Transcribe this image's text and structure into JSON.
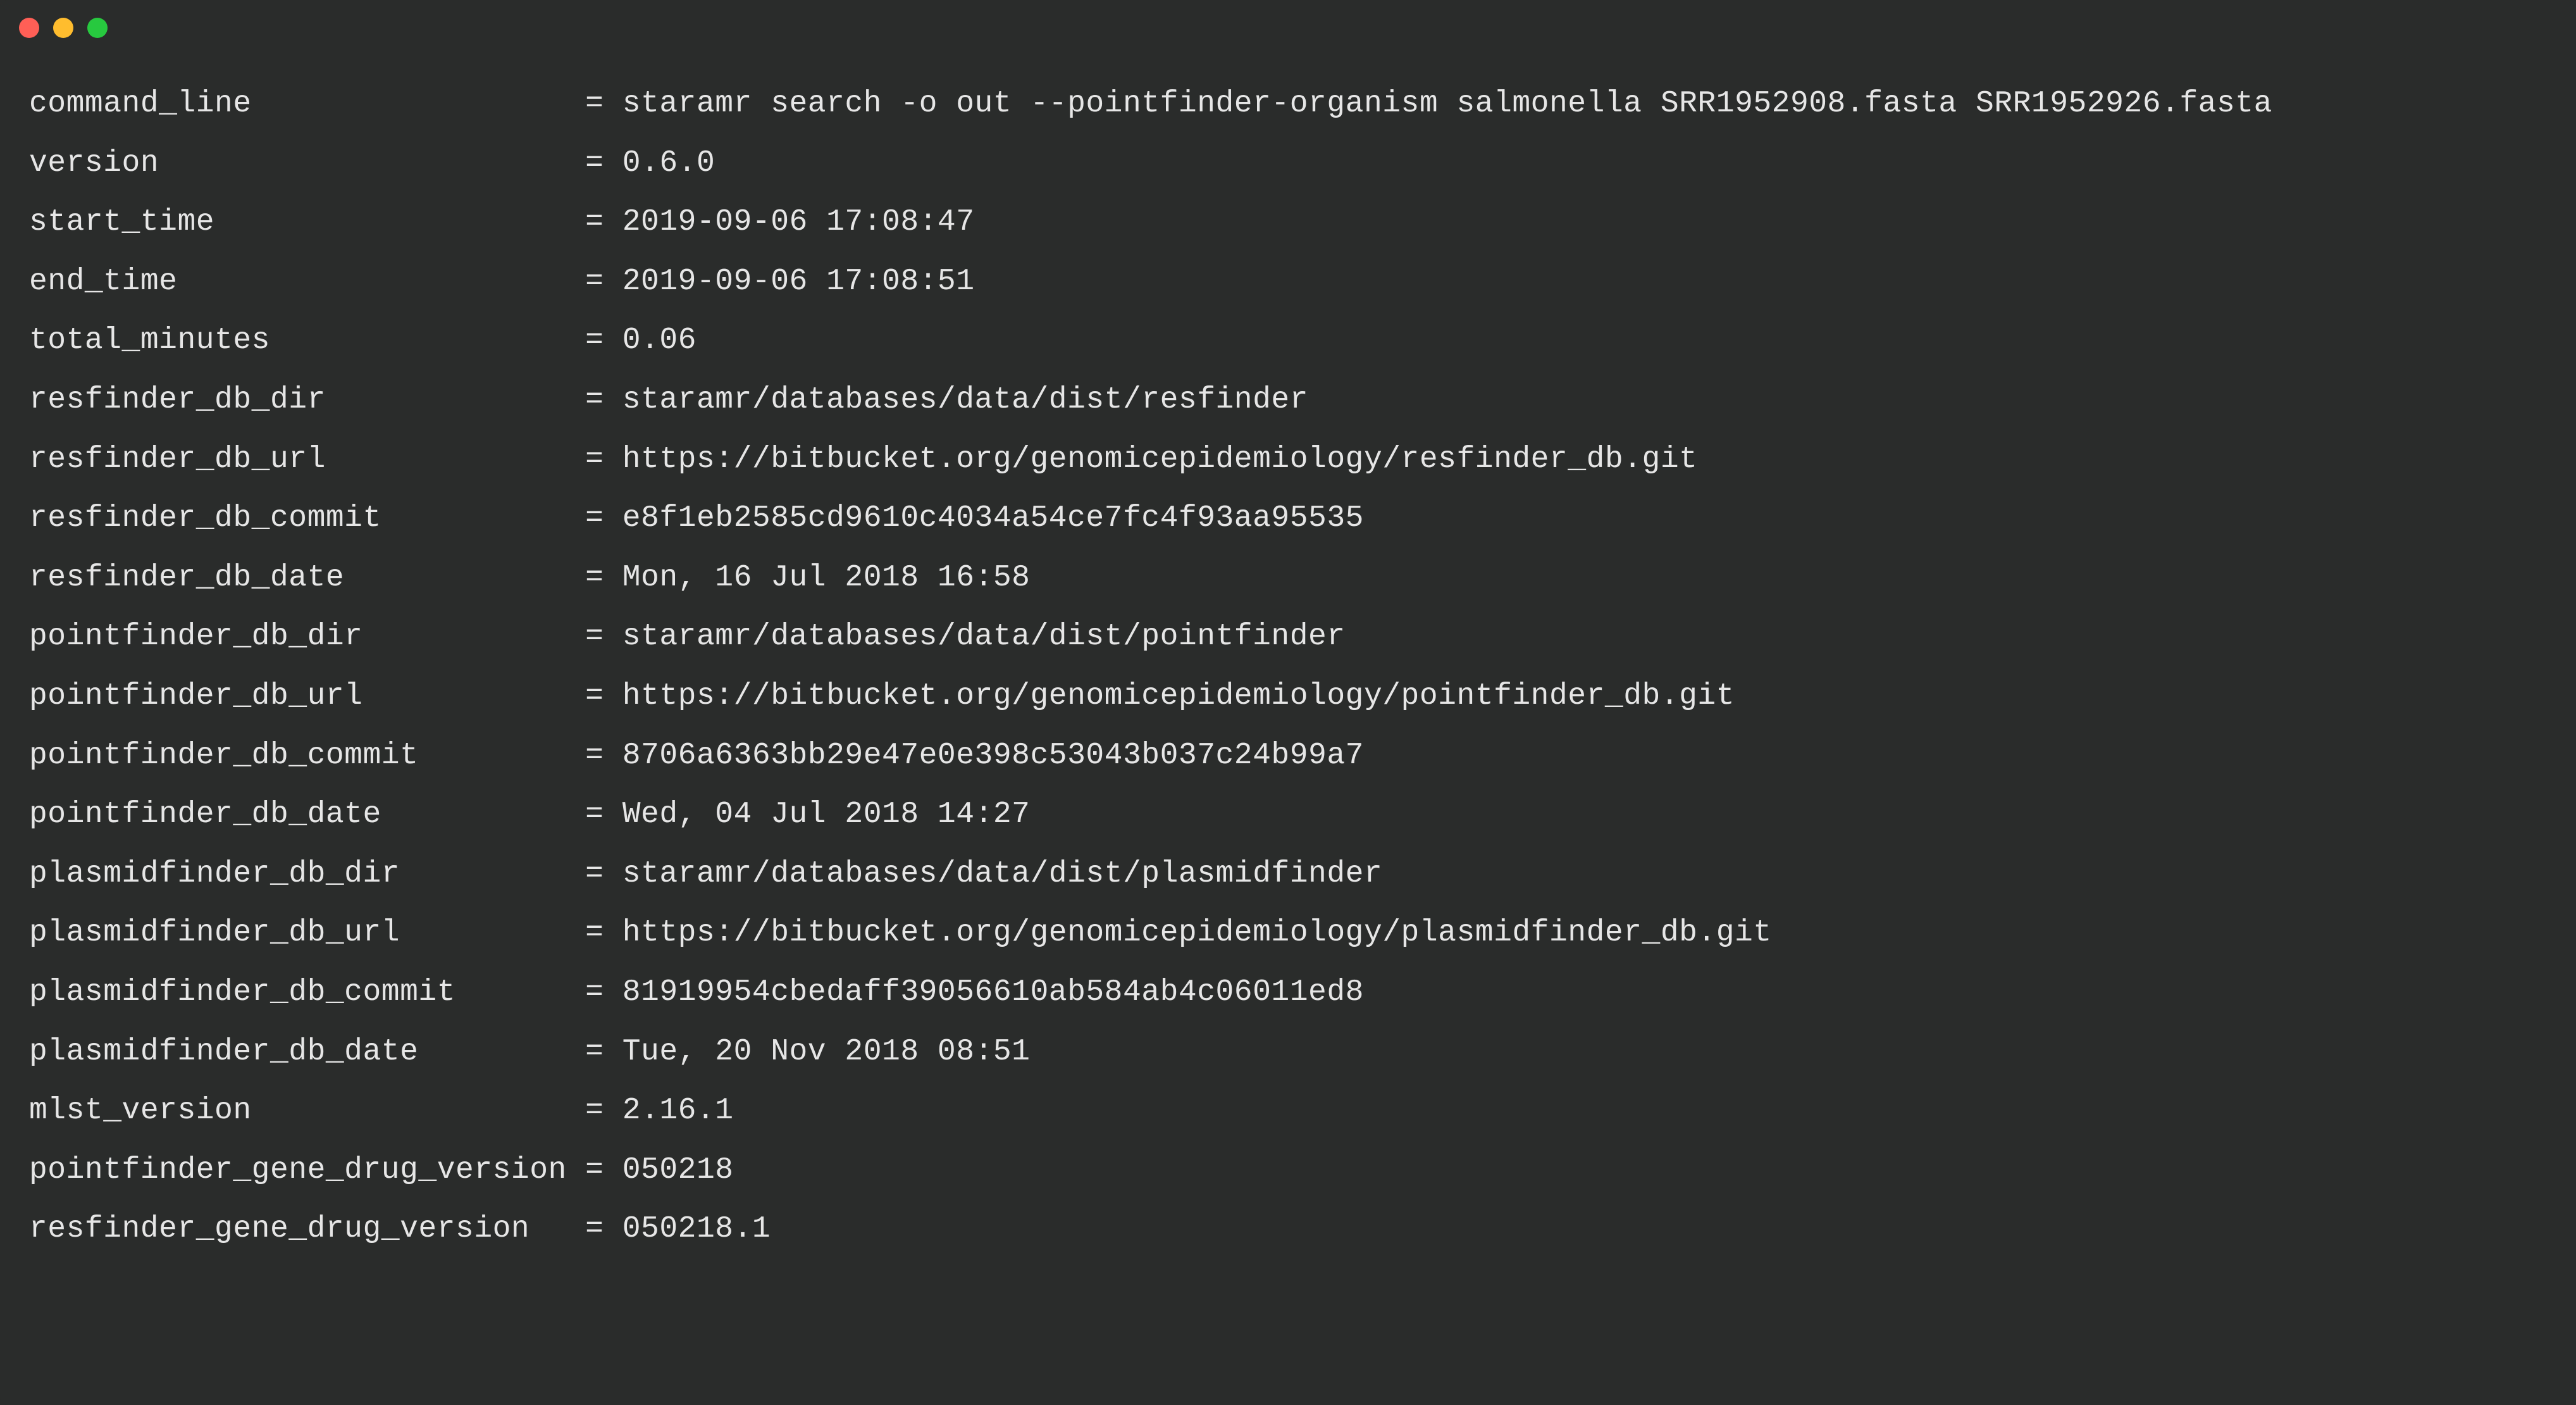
{
  "entries": [
    {
      "key": "command_line",
      "value": "staramr search -o out --pointfinder-organism salmonella SRR1952908.fasta SRR1952926.fasta"
    },
    {
      "key": "version",
      "value": "0.6.0"
    },
    {
      "key": "start_time",
      "value": "2019-09-06 17:08:47"
    },
    {
      "key": "end_time",
      "value": "2019-09-06 17:08:51"
    },
    {
      "key": "total_minutes",
      "value": "0.06"
    },
    {
      "key": "resfinder_db_dir",
      "value": "staramr/databases/data/dist/resfinder"
    },
    {
      "key": "resfinder_db_url",
      "value": "https://bitbucket.org/genomicepidemiology/resfinder_db.git"
    },
    {
      "key": "resfinder_db_commit",
      "value": "e8f1eb2585cd9610c4034a54ce7fc4f93aa95535"
    },
    {
      "key": "resfinder_db_date",
      "value": "Mon, 16 Jul 2018 16:58"
    },
    {
      "key": "pointfinder_db_dir",
      "value": "staramr/databases/data/dist/pointfinder"
    },
    {
      "key": "pointfinder_db_url",
      "value": "https://bitbucket.org/genomicepidemiology/pointfinder_db.git"
    },
    {
      "key": "pointfinder_db_commit",
      "value": "8706a6363bb29e47e0e398c53043b037c24b99a7"
    },
    {
      "key": "pointfinder_db_date",
      "value": "Wed, 04 Jul 2018 14:27"
    },
    {
      "key": "plasmidfinder_db_dir",
      "value": "staramr/databases/data/dist/plasmidfinder"
    },
    {
      "key": "plasmidfinder_db_url",
      "value": "https://bitbucket.org/genomicepidemiology/plasmidfinder_db.git"
    },
    {
      "key": "plasmidfinder_db_commit",
      "value": "81919954cbedaff39056610ab584ab4c06011ed8"
    },
    {
      "key": "plasmidfinder_db_date",
      "value": "Tue, 20 Nov 2018 08:51"
    },
    {
      "key": "mlst_version",
      "value": "2.16.1"
    },
    {
      "key": "pointfinder_gene_drug_version",
      "value": "050218"
    },
    {
      "key": "resfinder_gene_drug_version",
      "value": "050218.1"
    }
  ],
  "separator": "= "
}
